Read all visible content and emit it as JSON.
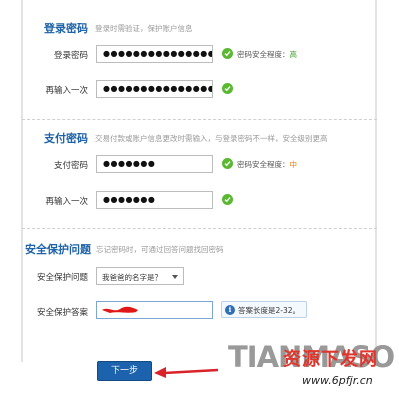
{
  "login": {
    "title": "登录密码",
    "desc": "登录时需验证，保护账户信息",
    "password_label": "登录密码",
    "password_value": "●●●●●●●●●●●●●●●",
    "strength_label": "密码安全程度：",
    "strength_value": "高",
    "confirm_label": "再输入一次",
    "confirm_value": "●●●●●●●●●●●●●●●"
  },
  "payment": {
    "title": "支付密码",
    "desc": "交易付款或账户信息更改时需输入，与登录密码不一样，安全级别更高",
    "password_label": "支付密码",
    "password_value": "●●●●●●●",
    "strength_label": "密码安全程度：",
    "strength_value": "中",
    "confirm_label": "再输入一次",
    "confirm_value": "●●●●●●●"
  },
  "security": {
    "title": "安全保护问题",
    "desc": "忘记密码时，可通过回答问题找回密码",
    "question_label": "安全保护问题",
    "question_value": "我爸爸的名字是？",
    "answer_label": "安全保护答案",
    "answer_tip": "答案长度是2-32。"
  },
  "next_button": "下一步",
  "watermark": {
    "brand": "TIANMASO",
    "cn": "资源下发网",
    "site": "www.6pfjr.cn"
  },
  "colors": {
    "title_blue": "#1e62a8",
    "ok_green": "#5ab832",
    "strength_high": "#3a9b27",
    "strength_mid": "#e07b00",
    "button_blue": "#1d62ac",
    "arrow_red": "#d8232a"
  }
}
